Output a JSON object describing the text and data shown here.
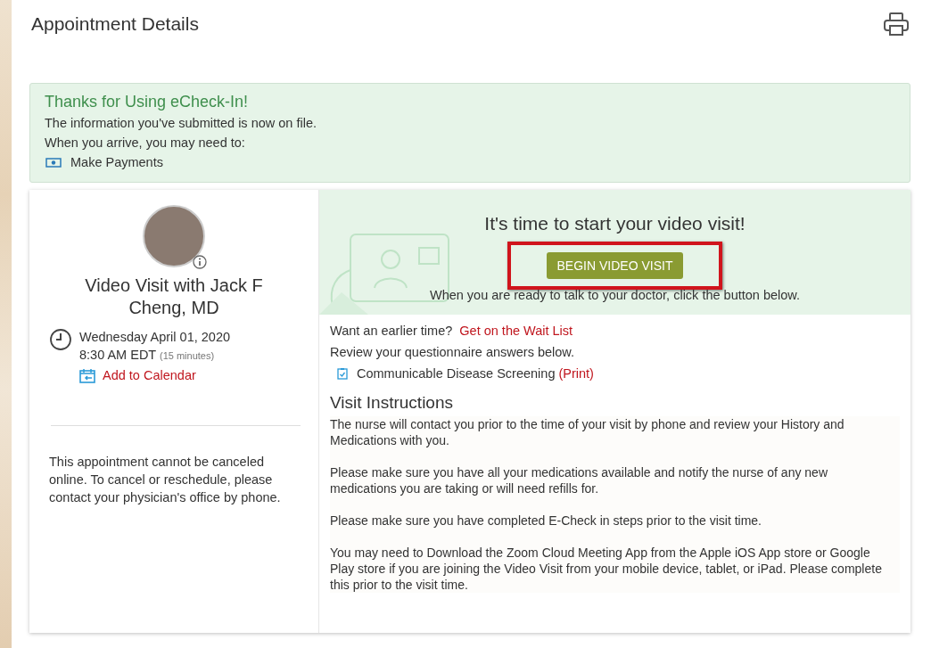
{
  "page": {
    "title": "Appointment Details"
  },
  "notice": {
    "title": "Thanks for Using eCheck-In!",
    "message": "The information you've submitted is now on file.",
    "prompt": "When you arrive, you may need to:",
    "tasks": [
      "Make Payments"
    ]
  },
  "appointment": {
    "title": "Video Visit with Jack F Cheng, MD",
    "date": "Wednesday April 01, 2020",
    "time": "8:30 AM EDT",
    "duration": "(15 minutes)",
    "calendar_link": "Add to Calendar",
    "cancel_note": "This appointment cannot be canceled online. To cancel or reschedule, please contact your physician's office by phone."
  },
  "video": {
    "heading": "It's time to start your video visit!",
    "button": "BEGIN VIDEO VISIT",
    "highlighted": true,
    "hint": "When you are ready to talk to your doctor, click the button below."
  },
  "waitlist": {
    "prompt": "Want an earlier time?",
    "link": "Get on the Wait List"
  },
  "questionnaire": {
    "prompt": "Review your questionnaire answers below.",
    "items": [
      {
        "name": "Communicable Disease Screening",
        "link": "(Print)"
      }
    ]
  },
  "instructions": {
    "heading": "Visit Instructions",
    "paragraphs": [
      "The nurse will contact you prior to the time of your visit by phone and review your History and Medications with you.",
      "Please make sure you have all your medications available and notify the nurse of any new medications you are taking or will need refills for.",
      "Please make sure you have completed E-Check in steps prior to the visit time.",
      "You may need to Download the Zoom Cloud Meeting App from the Apple iOS App store or Google Play store if you are joining the Video Visit from your mobile device, tablet, or iPad. Please complete this prior to the visit time."
    ]
  }
}
